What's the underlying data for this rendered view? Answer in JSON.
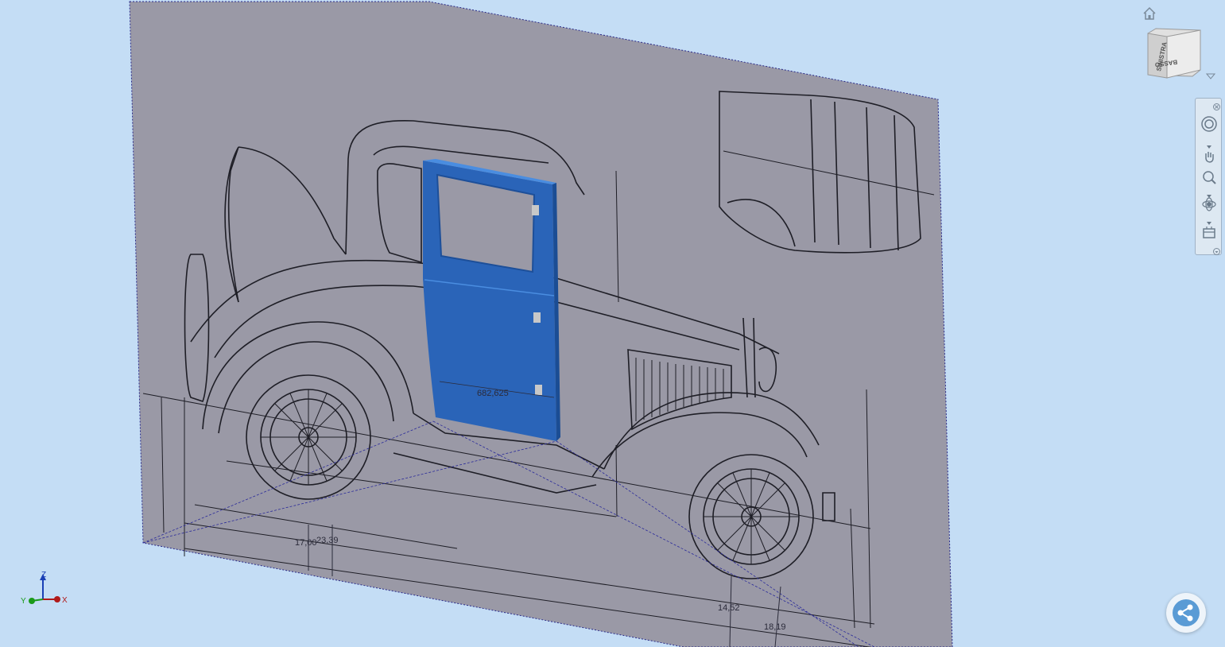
{
  "viewcube": {
    "left_face": "SINISTRA",
    "right_face": "BASSO"
  },
  "dimensions": {
    "door_width": "682,625",
    "dim_a": "17,00",
    "dim_b": "23,39",
    "dim_c": "14,52",
    "dim_d": "18,19"
  },
  "triad": {
    "z": "Z",
    "y": "Y",
    "x": "X"
  },
  "colors": {
    "background": "#c4ddf5",
    "sheet": "#9a99a6",
    "door": "#2b6fc4",
    "sketch": "#1e1e26"
  }
}
